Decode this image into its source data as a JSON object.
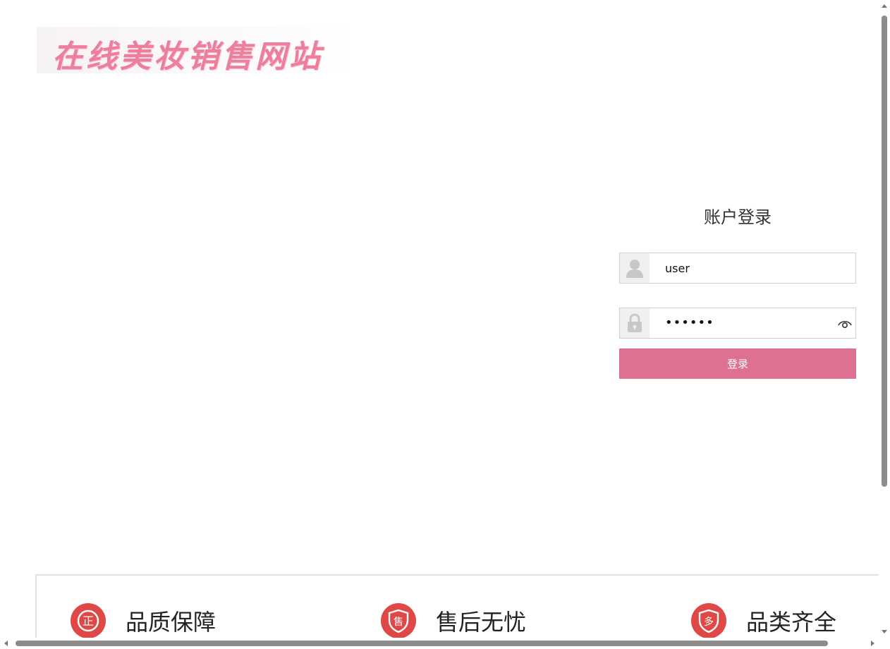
{
  "logo": {
    "text": "在线美妆销售网站"
  },
  "login": {
    "title": "账户登录",
    "username_value": "user",
    "password_dots": "••••••",
    "submit_label": "登录"
  },
  "features": [
    {
      "label": "品质保障",
      "icon": "certified-badge-icon",
      "glyph": "正"
    },
    {
      "label": "售后无忧",
      "icon": "aftersale-shield-icon",
      "glyph": "售"
    },
    {
      "label": "品类齐全",
      "icon": "variety-shield-icon",
      "glyph": "多"
    }
  ],
  "colors": {
    "brand_pink": "#de7091",
    "logo_pink": "#ee7f9c",
    "badge_red": "#e04848"
  }
}
